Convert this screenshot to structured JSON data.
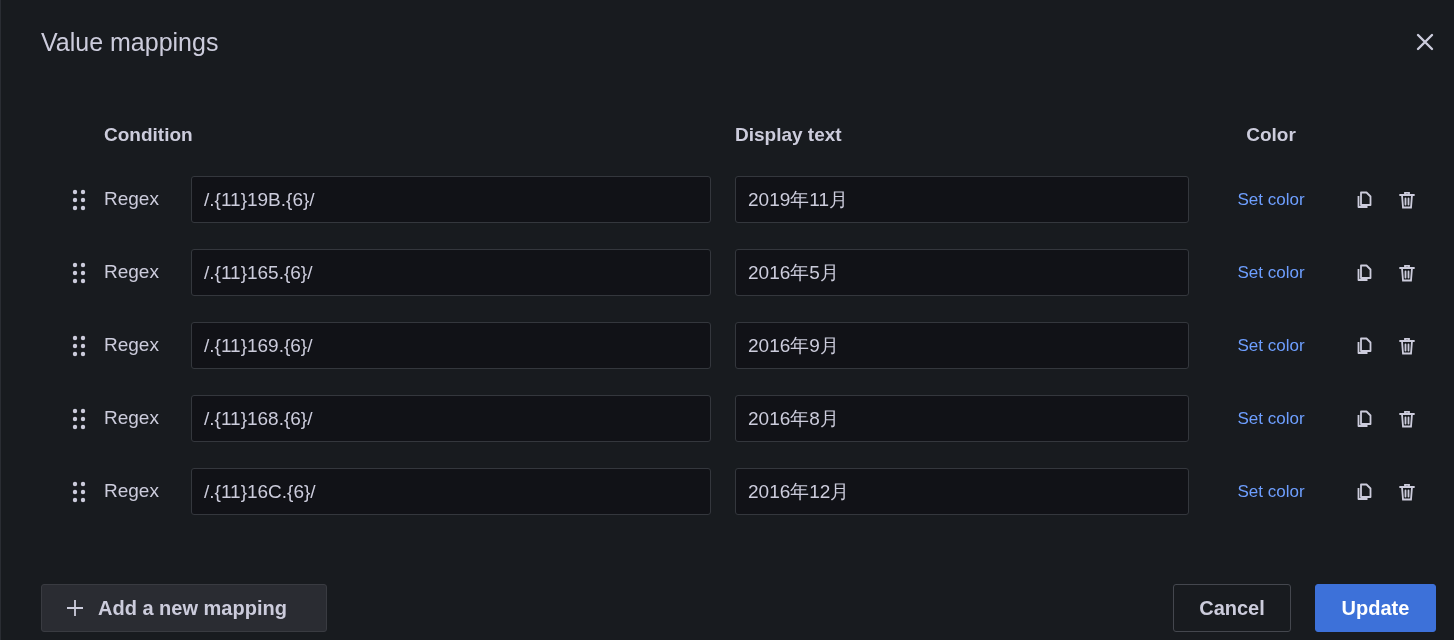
{
  "dialog": {
    "title": "Value mappings"
  },
  "columns": [
    "Condition",
    "Display text",
    "Color"
  ],
  "mappings": [
    {
      "type": "Regex",
      "condition": "/.{11}19B.{6}/",
      "display_text": "2019年11月",
      "color_action": "Set color"
    },
    {
      "type": "Regex",
      "condition": "/.{11}165.{6}/",
      "display_text": "2016年5月",
      "color_action": "Set color"
    },
    {
      "type": "Regex",
      "condition": "/.{11}169.{6}/",
      "display_text": "2016年9月",
      "color_action": "Set color"
    },
    {
      "type": "Regex",
      "condition": "/.{11}168.{6}/",
      "display_text": "2016年8月",
      "color_action": "Set color"
    },
    {
      "type": "Regex",
      "condition": "/.{11}16C.{6}/",
      "display_text": "2016年12月",
      "color_action": "Set color"
    }
  ],
  "add_button": "Add a new mapping",
  "buttons": [
    {
      "label": "Cancel",
      "kind": "secondary"
    },
    {
      "label": "Update",
      "kind": "primary"
    }
  ]
}
